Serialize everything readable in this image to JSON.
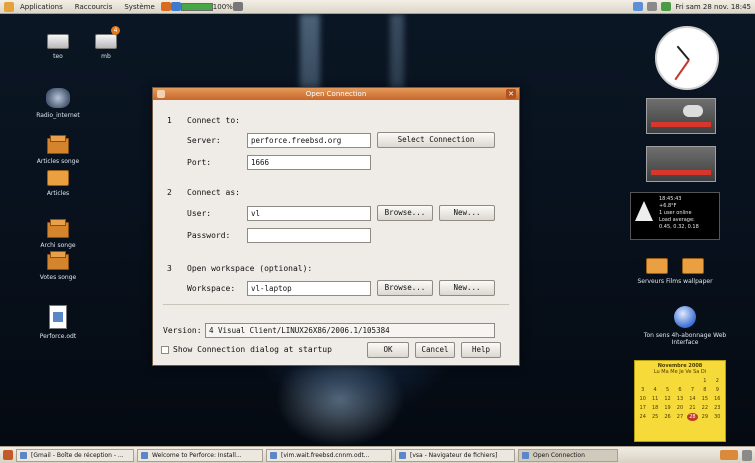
{
  "top_panel": {
    "menus": [
      "Applications",
      "Raccourcis",
      "Système"
    ],
    "battery_percent": "100%",
    "battery_level": 1.0,
    "clock": "Fri sam 28 nov. 18:45"
  },
  "desktop_icons": [
    {
      "name": "drive",
      "label": "teo",
      "icon": "drive-icon"
    },
    {
      "name": "home",
      "label": "mb",
      "icon": "drive-icon",
      "badge": "4"
    },
    {
      "name": "network",
      "label": "Radio_internet",
      "icon": "network-icon"
    },
    {
      "name": "box1",
      "label": "Articles songe",
      "icon": "box-icon"
    },
    {
      "name": "folder1",
      "label": "Articles",
      "icon": "folder-icon"
    },
    {
      "name": "box2",
      "label": "Archi songe",
      "icon": "box-icon"
    },
    {
      "name": "box3",
      "label": "Votes songe",
      "icon": "box-icon"
    },
    {
      "name": "doc",
      "label": "Perforce.odt",
      "icon": "document-icon"
    },
    {
      "name": "folders-right",
      "label": "Serveurs Films wallpaper",
      "icon": "folder-icon"
    },
    {
      "name": "globe",
      "label": "Ton sens 4h-abonnage Web Interface",
      "icon": "globe-icon"
    }
  ],
  "sysmon": {
    "lines": [
      "18:45:43",
      "+6.8°F",
      "1 user online",
      "Load average:",
      "0.45, 0.32, 0.18"
    ]
  },
  "calendar": {
    "title": "Novembre 2008",
    "weekdays": "Lu Ma Me Je Ve Sa Di",
    "days": [
      "",
      "",
      "",
      "",
      "",
      "1",
      "2",
      "3",
      "4",
      "5",
      "6",
      "7",
      "8",
      "9",
      "10",
      "11",
      "12",
      "13",
      "14",
      "15",
      "16",
      "17",
      "18",
      "19",
      "20",
      "21",
      "22",
      "23",
      "24",
      "25",
      "26",
      "27",
      "28",
      "29",
      "30"
    ],
    "today": "28"
  },
  "dialog": {
    "title": "Open Connection",
    "section1": {
      "number": "1",
      "title": "Connect to:"
    },
    "server_label": "Server:",
    "server_value": "perforce.freebsd.org",
    "select_connection_button": "Select Connection",
    "port_label": "Port:",
    "port_value": "1666",
    "section2": {
      "number": "2",
      "title": "Connect as:"
    },
    "user_label": "User:",
    "user_value": "vl",
    "browse_user_button": "Browse...",
    "new_user_button": "New...",
    "password_label": "Password:",
    "password_value": "",
    "section3": {
      "number": "3",
      "title": "Open workspace (optional):"
    },
    "workspace_label": "Workspace:",
    "workspace_value": "vl-laptop",
    "browse_workspace_button": "Browse...",
    "new_workspace_button": "New...",
    "version_label": "Version:",
    "version_value": "P4V/LINUX26X86/2006.1/105384",
    "version_display": "4 Visual Client/LINUX26X86/2006.1/105384",
    "show_dialog_label": "Show Connection dialog at startup",
    "ok_button": "OK",
    "cancel_button": "Cancel",
    "help_button": "Help"
  },
  "taskbar": {
    "tasks": [
      {
        "label": "[Gmail - Boîte de réception - ...",
        "active": false
      },
      {
        "label": "Welcome to Perforce: Install...",
        "active": false
      },
      {
        "label": "[vim.wait.freebsd.cnnm.odt...",
        "active": false
      },
      {
        "label": "[vsa - Navigateur de fichiers]",
        "active": false
      },
      {
        "label": "Open Connection",
        "active": true
      }
    ]
  }
}
